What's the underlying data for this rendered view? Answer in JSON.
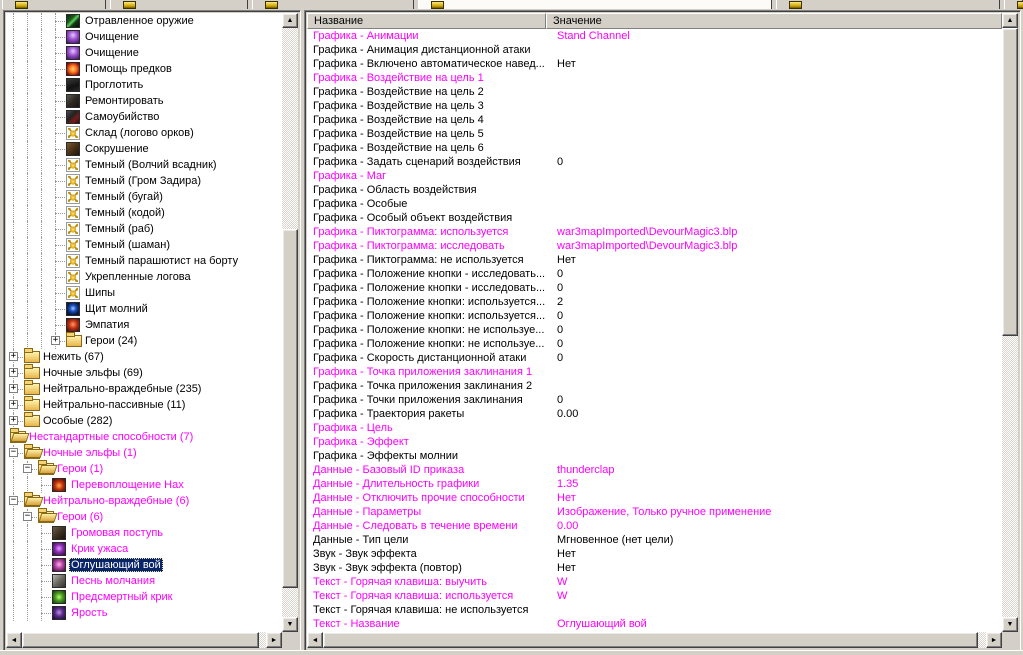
{
  "colors": {
    "modified_magenta": "#FF00FF",
    "selection_bg": "#0A246A",
    "window_bg": "#D4D0C8",
    "panel_bg": "#FFFFFF"
  },
  "tabs": {
    "active_index": 3,
    "items": [
      {
        "icon": "editor-tab"
      },
      {
        "icon": "editor-tab"
      },
      {
        "icon": "editor-tab"
      },
      {
        "icon": "editor-tab"
      },
      {
        "icon": "editor-tab"
      },
      {
        "icon": "editor-tab"
      }
    ]
  },
  "tree": {
    "items": [
      {
        "label": "Отравленное оружие",
        "depth": 4,
        "icon": "poison-weapon",
        "box": null,
        "custom": false,
        "selected": false
      },
      {
        "label": "Очищение",
        "depth": 4,
        "icon": "purge",
        "box": null,
        "custom": false,
        "selected": false
      },
      {
        "label": "Очищение",
        "depth": 4,
        "icon": "purge",
        "box": null,
        "custom": false,
        "selected": false
      },
      {
        "label": "Помощь предков",
        "depth": 4,
        "icon": "ancestral-aid",
        "box": null,
        "custom": false,
        "selected": false
      },
      {
        "label": "Проглотить",
        "depth": 4,
        "icon": "devour",
        "box": null,
        "custom": false,
        "selected": false
      },
      {
        "label": "Ремонтировать",
        "depth": 4,
        "icon": "repair",
        "box": null,
        "custom": false,
        "selected": false
      },
      {
        "label": "Самоубийство",
        "depth": 4,
        "icon": "suicide",
        "box": null,
        "custom": false,
        "selected": false
      },
      {
        "label": "Склад (логово орков)",
        "depth": 4,
        "icon": "burrow-claw",
        "box": null,
        "custom": false,
        "selected": false
      },
      {
        "label": "Сокрушение",
        "depth": 4,
        "icon": "crush",
        "box": null,
        "custom": false,
        "selected": false
      },
      {
        "label": "Темный (Волчий всадник)",
        "depth": 4,
        "icon": "burrow-claw",
        "box": null,
        "custom": false,
        "selected": false
      },
      {
        "label": "Темный (Гром Задира)",
        "depth": 4,
        "icon": "burrow-claw",
        "box": null,
        "custom": false,
        "selected": false
      },
      {
        "label": "Темный (бугай)",
        "depth": 4,
        "icon": "burrow-claw",
        "box": null,
        "custom": false,
        "selected": false
      },
      {
        "label": "Темный (кодой)",
        "depth": 4,
        "icon": "burrow-claw",
        "box": null,
        "custom": false,
        "selected": false
      },
      {
        "label": "Темный (раб)",
        "depth": 4,
        "icon": "burrow-claw",
        "box": null,
        "custom": false,
        "selected": false
      },
      {
        "label": "Темный (шаман)",
        "depth": 4,
        "icon": "burrow-claw",
        "box": null,
        "custom": false,
        "selected": false
      },
      {
        "label": "Темный парашютист на борту",
        "depth": 4,
        "icon": "burrow-claw",
        "box": null,
        "custom": false,
        "selected": false
      },
      {
        "label": "Укрепленные логова",
        "depth": 4,
        "icon": "burrow-claw",
        "box": null,
        "custom": false,
        "selected": false
      },
      {
        "label": "Шипы",
        "depth": 4,
        "icon": "burrow-claw",
        "box": null,
        "custom": false,
        "selected": false
      },
      {
        "label": "Щит молний",
        "depth": 4,
        "icon": "lightning-shield",
        "box": null,
        "custom": false,
        "selected": false
      },
      {
        "label": "Эмпатия",
        "depth": 4,
        "icon": "empathy",
        "box": null,
        "custom": false,
        "selected": false
      },
      {
        "label": "Герои (24)",
        "depth": 4,
        "icon": "folder-closed",
        "box": "+",
        "custom": false,
        "selected": false
      },
      {
        "label": "Нежить (67)",
        "depth": 1,
        "icon": "folder-closed",
        "box": "+",
        "custom": false,
        "selected": false
      },
      {
        "label": "Ночные эльфы (69)",
        "depth": 1,
        "icon": "folder-closed",
        "box": "+",
        "custom": false,
        "selected": false
      },
      {
        "label": "Нейтрально-враждебные (235)",
        "depth": 1,
        "icon": "folder-closed",
        "box": "+",
        "custom": false,
        "selected": false
      },
      {
        "label": "Нейтрально-пассивные (11)",
        "depth": 1,
        "icon": "folder-closed",
        "box": "+",
        "custom": false,
        "selected": false
      },
      {
        "label": "Особые (282)",
        "depth": 1,
        "icon": "folder-closed",
        "box": "+",
        "custom": false,
        "selected": false
      },
      {
        "label": "Нестандартные способности (7)",
        "depth": 0,
        "icon": "folder-open",
        "box": null,
        "custom": true,
        "selected": false
      },
      {
        "label": "Ночные эльфы (1)",
        "depth": 1,
        "icon": "folder-open",
        "box": "-",
        "custom": true,
        "selected": false
      },
      {
        "label": "Герои (1)",
        "depth": 2,
        "icon": "folder-open",
        "box": "-",
        "custom": true,
        "selected": false
      },
      {
        "label": "Перевоплощение Нах",
        "depth": 3,
        "icon": "reincarnation",
        "box": null,
        "custom": true,
        "selected": false
      },
      {
        "label": "Нейтрально-враждебные (6)",
        "depth": 1,
        "icon": "folder-open",
        "box": "-",
        "custom": true,
        "selected": false
      },
      {
        "label": "Герои (6)",
        "depth": 2,
        "icon": "folder-open",
        "box": "-",
        "custom": true,
        "selected": false
      },
      {
        "label": "Громовая поступь",
        "depth": 3,
        "icon": "thunder-tread",
        "box": null,
        "custom": true,
        "selected": false
      },
      {
        "label": "Крик ужаса",
        "depth": 3,
        "icon": "terror-shout",
        "box": null,
        "custom": true,
        "selected": false
      },
      {
        "label": "Оглушающий вой",
        "depth": 3,
        "icon": "stunning-howl",
        "box": null,
        "custom": true,
        "selected": true
      },
      {
        "label": "Песнь молчания",
        "depth": 3,
        "icon": "silence-song",
        "box": null,
        "custom": true,
        "selected": false
      },
      {
        "label": "Предсмертный крик",
        "depth": 3,
        "icon": "death-cry",
        "box": null,
        "custom": true,
        "selected": false
      },
      {
        "label": "Ярость",
        "depth": 3,
        "icon": "rage",
        "box": null,
        "custom": true,
        "selected": false
      }
    ]
  },
  "properties": {
    "header": {
      "name": "Название",
      "value": "Значение"
    },
    "rows": [
      {
        "name": "Графика - Анимации",
        "value": "Stand Channel",
        "modified": true
      },
      {
        "name": "Графика - Анимация дистанционной атаки",
        "value": "",
        "modified": false
      },
      {
        "name": "Графика - Включено автоматическое навед...",
        "value": "Нет",
        "modified": false
      },
      {
        "name": "Графика - Воздействие на цель 1",
        "value": "",
        "modified": true
      },
      {
        "name": "Графика - Воздействие на цель 2",
        "value": "",
        "modified": false
      },
      {
        "name": "Графика - Воздействие на цель 3",
        "value": "",
        "modified": false
      },
      {
        "name": "Графика - Воздействие на цель 4",
        "value": "",
        "modified": false
      },
      {
        "name": "Графика - Воздействие на цель 5",
        "value": "",
        "modified": false
      },
      {
        "name": "Графика - Воздействие на цель 6",
        "value": "",
        "modified": false
      },
      {
        "name": "Графика - Задать сценарий воздействия",
        "value": "0",
        "modified": false
      },
      {
        "name": "Графика - Маг",
        "value": "",
        "modified": true
      },
      {
        "name": "Графика - Область воздействия",
        "value": "",
        "modified": false
      },
      {
        "name": "Графика - Особые",
        "value": "",
        "modified": false
      },
      {
        "name": "Графика - Особый объект воздействия",
        "value": "",
        "modified": false
      },
      {
        "name": "Графика - Пиктограмма: используется",
        "value": "war3mapImported\\DevourMagic3.blp",
        "modified": true
      },
      {
        "name": "Графика - Пиктограмма: исследовать",
        "value": "war3mapImported\\DevourMagic3.blp",
        "modified": true
      },
      {
        "name": "Графика - Пиктограмма: не используется",
        "value": "Нет",
        "modified": false
      },
      {
        "name": "Графика - Положение кнопки - исследовать...",
        "value": "0",
        "modified": false
      },
      {
        "name": "Графика - Положение кнопки - исследовать...",
        "value": "0",
        "modified": false
      },
      {
        "name": "Графика - Положение кнопки: используется...",
        "value": "2",
        "modified": false
      },
      {
        "name": "Графика - Положение кнопки: используется...",
        "value": "0",
        "modified": false
      },
      {
        "name": "Графика - Положение кнопки: не используе...",
        "value": "0",
        "modified": false
      },
      {
        "name": "Графика - Положение кнопки: не используе...",
        "value": "0",
        "modified": false
      },
      {
        "name": "Графика - Скорость дистанционной атаки",
        "value": "0",
        "modified": false
      },
      {
        "name": "Графика - Точка приложения заклинания 1",
        "value": "",
        "modified": true
      },
      {
        "name": "Графика - Точка приложения заклинания 2",
        "value": "",
        "modified": false
      },
      {
        "name": "Графика - Точки приложения заклинания",
        "value": "0",
        "modified": false
      },
      {
        "name": "Графика - Траектория ракеты",
        "value": "0.00",
        "modified": false
      },
      {
        "name": "Графика - Цель",
        "value": "",
        "modified": true
      },
      {
        "name": "Графика - Эффект",
        "value": "",
        "modified": true
      },
      {
        "name": "Графика - Эффекты молнии",
        "value": "",
        "modified": false
      },
      {
        "name": "Данные - Базовый ID приказа",
        "value": "thunderclap",
        "modified": true
      },
      {
        "name": "Данные - Длительность графики",
        "value": "1.35",
        "modified": true
      },
      {
        "name": "Данные - Отключить прочие способности",
        "value": "Нет",
        "modified": true
      },
      {
        "name": "Данные - Параметры",
        "value": "Изображение, Только ручное применение",
        "modified": true
      },
      {
        "name": "Данные - Следовать в течение времени",
        "value": "0.00",
        "modified": true
      },
      {
        "name": "Данные - Тип цели",
        "value": "Мгновенное (нет цели)",
        "modified": false
      },
      {
        "name": "Звук - Звук эффекта",
        "value": "Нет",
        "modified": false
      },
      {
        "name": "Звук - Звук эффекта (повтор)",
        "value": "Нет",
        "modified": false
      },
      {
        "name": "Текст - Горячая клавиша: выучить",
        "value": "W",
        "modified": true
      },
      {
        "name": "Текст - Горячая клавиша: используется",
        "value": "W",
        "modified": true
      },
      {
        "name": "Текст - Горячая клавиша: не используется",
        "value": "",
        "modified": false
      },
      {
        "name": "Текст - Название",
        "value": "Оглушающий вой",
        "modified": true
      }
    ]
  }
}
